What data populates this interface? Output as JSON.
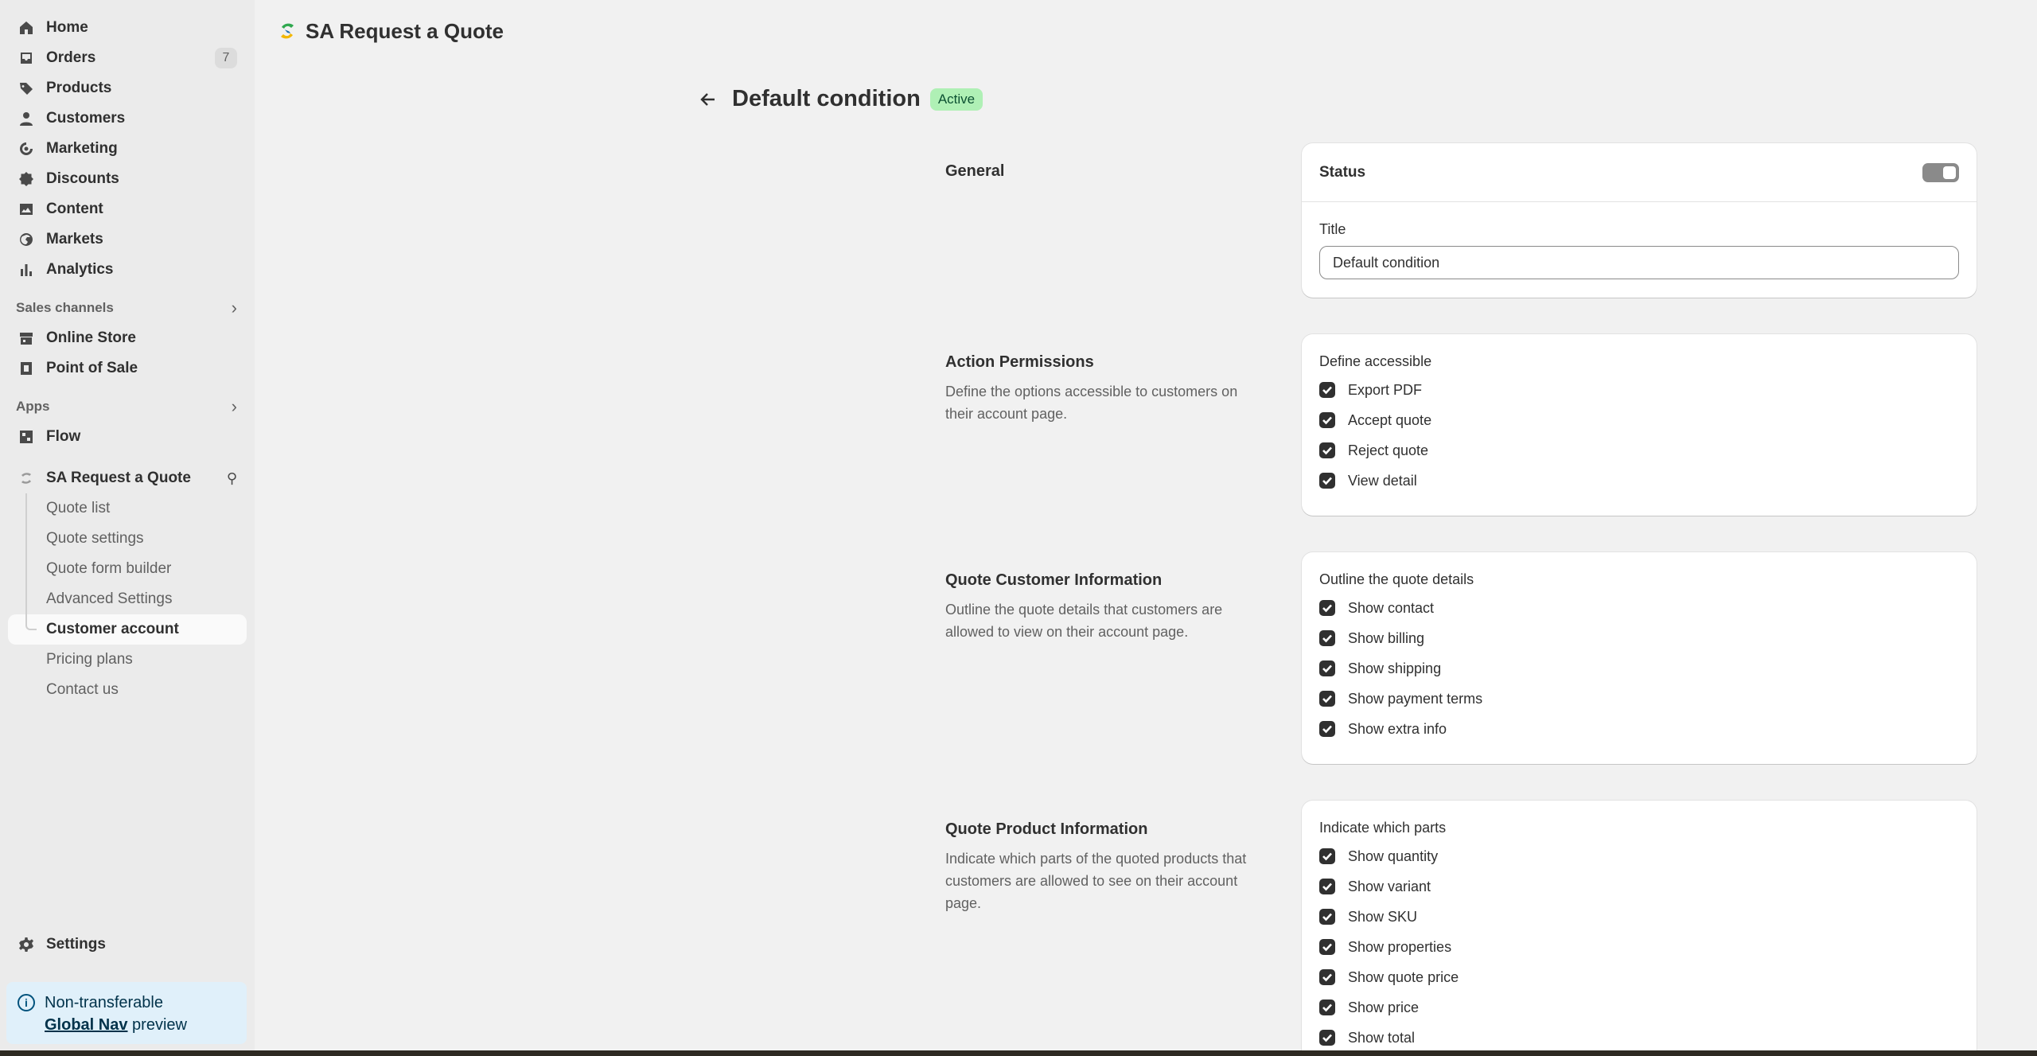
{
  "sidebar": {
    "nav": [
      {
        "label": "Home",
        "icon": "home-icon"
      },
      {
        "label": "Orders",
        "icon": "inbox-icon",
        "badge": "7"
      },
      {
        "label": "Products",
        "icon": "tag-icon"
      },
      {
        "label": "Customers",
        "icon": "person-icon"
      },
      {
        "label": "Marketing",
        "icon": "target-icon"
      },
      {
        "label": "Discounts",
        "icon": "discount-icon"
      },
      {
        "label": "Content",
        "icon": "image-icon"
      },
      {
        "label": "Markets",
        "icon": "globe-icon"
      },
      {
        "label": "Analytics",
        "icon": "bar-chart-icon"
      }
    ],
    "sales_channels_label": "Sales channels",
    "sales_channels": [
      {
        "label": "Online Store",
        "icon": "store-icon"
      },
      {
        "label": "Point of Sale",
        "icon": "pos-icon"
      }
    ],
    "apps_label": "Apps",
    "apps": [
      {
        "label": "Flow",
        "icon": "flow-icon"
      }
    ],
    "app_name": "SA Request a Quote",
    "app_sub": [
      {
        "label": "Quote list"
      },
      {
        "label": "Quote settings"
      },
      {
        "label": "Quote form builder"
      },
      {
        "label": "Advanced Settings"
      },
      {
        "label": "Customer account",
        "active": true
      },
      {
        "label": "Pricing plans"
      },
      {
        "label": "Contact us"
      }
    ],
    "settings_label": "Settings",
    "notice": {
      "line1": "Non-transferable",
      "link": "Global Nav",
      "rest": " preview"
    }
  },
  "header": {
    "app_title": "SA Request a Quote"
  },
  "page": {
    "title": "Default condition",
    "status_badge": "Active"
  },
  "general": {
    "label": "General",
    "status_label": "Status",
    "status_on": true,
    "title_label": "Title",
    "title_value": "Default condition"
  },
  "action_permissions": {
    "label": "Action Permissions",
    "description": "Define the options accessible to customers on their account page.",
    "group_title": "Define accessible",
    "options": [
      "Export PDF",
      "Accept quote",
      "Reject quote",
      "View detail"
    ]
  },
  "customer_info": {
    "label": "Quote Customer Information",
    "description": "Outline the quote details that customers are allowed to view on their account page.",
    "group_title": "Outline the quote details",
    "options": [
      "Show contact",
      "Show billing",
      "Show shipping",
      "Show payment terms",
      "Show extra info"
    ]
  },
  "product_info": {
    "label": "Quote Product Information",
    "description": "Indicate which parts of the quoted products that customers are allowed to see on their account page.",
    "group_title": "Indicate which parts",
    "options": [
      "Show quantity",
      "Show variant",
      "Show SKU",
      "Show properties",
      "Show quote price",
      "Show price",
      "Show total"
    ]
  },
  "colors": {
    "sidebar_bg": "#ebebeb",
    "main_bg": "#f1f1f1",
    "badge_active_bg": "#aff0b5",
    "notice_bg": "#e0f0fa"
  }
}
